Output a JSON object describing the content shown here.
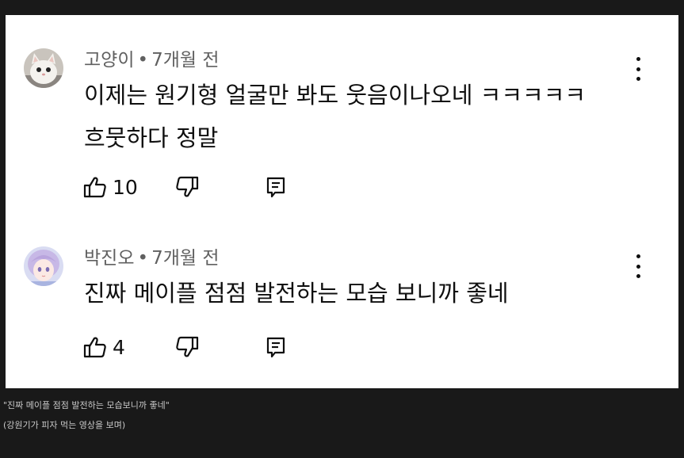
{
  "comments": [
    {
      "author": "고양이",
      "separator": "•",
      "time": "7개월 전",
      "lines": [
        "이제는 원기형 얼굴만 봐도 웃음이나오네 ㅋㅋㅋㅋㅋ",
        "흐뭇하다 정말"
      ],
      "likes": "10",
      "avatar_icon": "cat-photo"
    },
    {
      "author": "박진오",
      "separator": "•",
      "time": "7개월 전",
      "lines": [
        "진짜 메이플 점점 발전하는 모습 보니까 좋네"
      ],
      "likes": "4",
      "avatar_icon": "anime-character"
    }
  ],
  "icons": {
    "like": "thumbs-up-icon",
    "dislike": "thumbs-down-icon",
    "reply": "reply-icon",
    "menu": "more-vert-icon"
  },
  "captions": [
    "\"진짜 메이플 점점 발전하는 모습보니까 좋네\"",
    "(강원기가 피자 먹는 영상을 보며)"
  ],
  "colors": {
    "background": "#191919",
    "panel": "#ffffff",
    "text": "#0f0f0f",
    "meta": "#606060",
    "caption": "#c9c9c9"
  }
}
